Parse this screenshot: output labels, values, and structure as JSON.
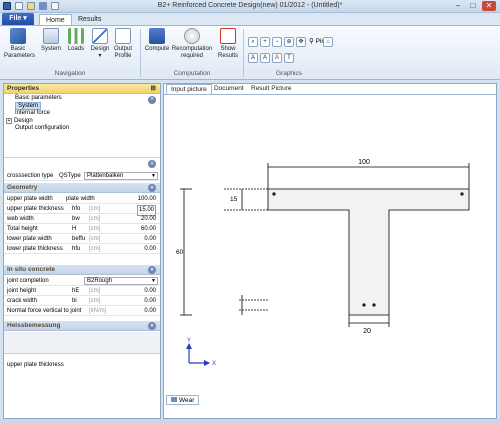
{
  "window": {
    "title": "B2+ Reinforced Concrete Design(new)  01/2012 - (Untitled)*"
  },
  "tabs": {
    "file": "File",
    "home": "Home",
    "results": "Results"
  },
  "ribbon": {
    "navigation": {
      "label": "Navigation",
      "basic_parameters": "Basic Parameters",
      "system": "System",
      "loads": "Loads",
      "design": "Design",
      "output_profile": "Output Profile"
    },
    "computation": {
      "label": "Computation",
      "compute": "Compute",
      "recomputation": "Recomputation required",
      "show_results": "Show Results"
    },
    "graphics": {
      "label": "Graphics",
      "pin": "Pin"
    }
  },
  "properties": {
    "header": "Properties",
    "tree": [
      "Basic parameters",
      "System",
      "Internal force",
      "Design",
      "Output configuration"
    ],
    "crosssection": {
      "label": "crosssection type",
      "symbol": "QSType",
      "value": "Plattenbalken"
    },
    "geometry": {
      "header": "Geometry",
      "rows": [
        {
          "label": "upper plate width",
          "sym": "plate width",
          "unit": "",
          "value": "100.00"
        },
        {
          "label": "upper plate thickness",
          "sym": "hfo",
          "unit": "[cm]",
          "value": "15.00"
        },
        {
          "label": "web width",
          "sym": "bw",
          "unit": "[cm]",
          "value": "20.00"
        },
        {
          "label": "Total height",
          "sym": "H",
          "unit": "[cm]",
          "value": "60.00"
        },
        {
          "label": "lower plate width",
          "sym": "beffu",
          "unit": "[cm]",
          "value": "0.00"
        },
        {
          "label": "lower plate thickness",
          "sym": "hfu",
          "unit": "[cm]",
          "value": "0.00"
        }
      ]
    },
    "insitu": {
      "header": "In situ concrete",
      "joint_label": "joint completion",
      "joint_value": "B2Rough",
      "rows": [
        {
          "label": "joint height",
          "sym": "hE",
          "unit": "[cm]",
          "value": "0.00"
        },
        {
          "label": "crack width",
          "sym": "bi",
          "unit": "[cm]",
          "value": "0.00"
        },
        {
          "label": "Normal force vertical to joint",
          "sym": "",
          "unit": "[kN/m]",
          "value": "0.00"
        }
      ]
    },
    "heiss": {
      "header": "Heissbemessung"
    },
    "description": "upper plate thickness"
  },
  "doc_tabs": [
    "Input picture",
    "Document",
    "Result Picture"
  ],
  "drawing": {
    "dim_top": "100",
    "dim_left_small": "15",
    "dim_left": "60",
    "dim_bottom": "20",
    "axis_x": "X",
    "axis_y": "Y"
  },
  "bottom_tab": "Wear"
}
